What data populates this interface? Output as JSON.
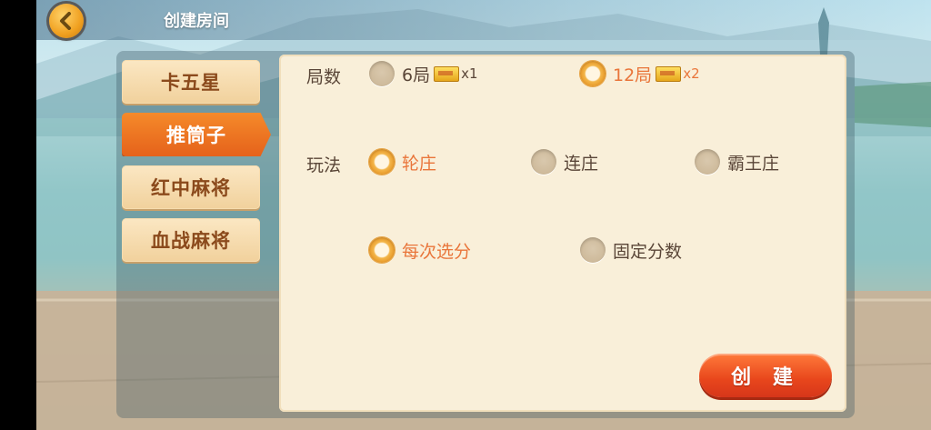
{
  "header": {
    "title": "创建房间"
  },
  "tabs": [
    {
      "label": "卡五星",
      "active": false
    },
    {
      "label": "推筒子",
      "active": true
    },
    {
      "label": "红中麻将",
      "active": false
    },
    {
      "label": "血战麻将",
      "active": false
    }
  ],
  "rounds": {
    "label": "局数",
    "options": [
      {
        "label": "6局",
        "multiplier": "x1",
        "selected": false
      },
      {
        "label": "12局",
        "multiplier": "x2",
        "selected": true
      }
    ]
  },
  "gameplay": {
    "label": "玩法",
    "options": [
      {
        "label": "轮庄",
        "selected": true
      },
      {
        "label": "连庄",
        "selected": false
      },
      {
        "label": "霸王庄",
        "selected": false
      }
    ]
  },
  "scoring": {
    "options": [
      {
        "label": "每次选分",
        "selected": true
      },
      {
        "label": "固定分数",
        "selected": false
      }
    ]
  },
  "actions": {
    "create_label": "创 建"
  },
  "colors": {
    "accent": "#e9753a",
    "button": "#e8461c",
    "panel": "#f9efd9"
  }
}
